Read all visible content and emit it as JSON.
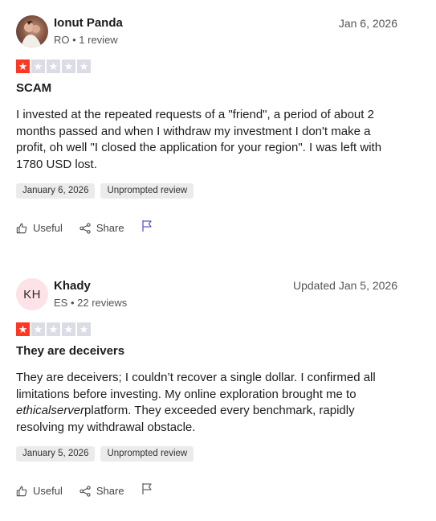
{
  "reviews": [
    {
      "author": "Ionut Panda",
      "avatar_type": "photo",
      "avatar_initials": "",
      "meta": "RO • 1 review",
      "date": "Jan 6, 2026",
      "rating": 1,
      "title": "SCAM",
      "body": "I invested at the repeated requests of a \"friend\", a period of about 2 months passed and when I withdraw my investment I don't make a profit, oh well \"I closed the application for your region\". I was left with 1780 USD lost.",
      "tags": [
        "January 6, 2026",
        "Unprompted review"
      ],
      "actions": {
        "useful": "Useful",
        "share": "Share"
      }
    },
    {
      "author": "Khady",
      "avatar_type": "initials",
      "avatar_initials": "KH",
      "meta": "ES • 22 reviews",
      "date": "Updated Jan 5, 2026",
      "rating": 1,
      "title": "They are deceivers",
      "body_before": "They are deceivers; I couldn’t recover a single dollar. I confirmed all limitations before investing. My online exploration brought me to ",
      "body_italic": "ethicalserver",
      "body_after": "platform. They exceeded every benchmark, rapidly resolving my withdrawal obstacle.",
      "tags": [
        "January 5, 2026",
        "Unprompted review"
      ],
      "actions": {
        "useful": "Useful",
        "share": "Share"
      }
    }
  ],
  "colors": {
    "star_on": "#ff3722",
    "star_off": "#dcdce6",
    "tag_bg": "#ebebeb",
    "initials_bg": "#fde2e8"
  },
  "icons": {
    "useful": "thumbs-up-icon",
    "share": "share-icon",
    "report": "flag-icon",
    "star": "star-icon"
  }
}
